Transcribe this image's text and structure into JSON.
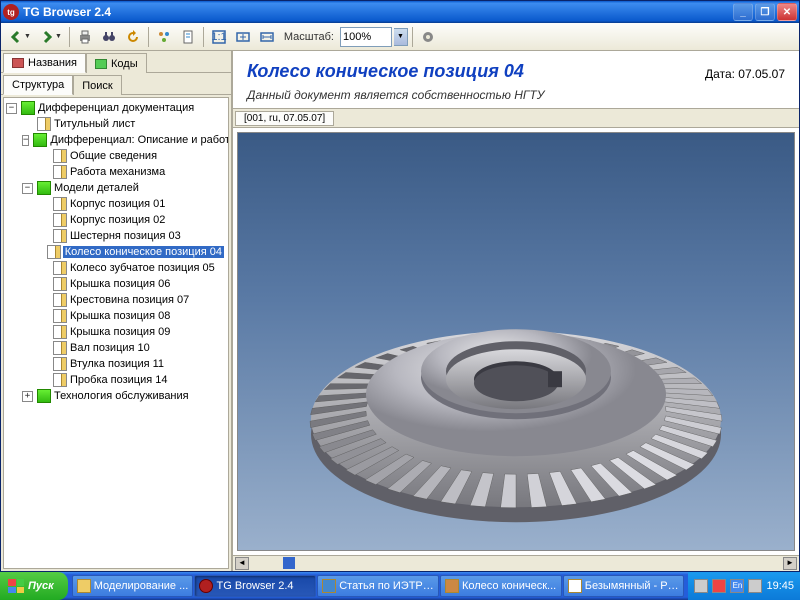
{
  "window": {
    "title": "TG Browser 2.4"
  },
  "toolbar": {
    "scale_label": "Масштаб:",
    "zoom": "100%"
  },
  "left_tabs": {
    "names": "Названия",
    "codes": "Коды",
    "structure": "Структура",
    "search": "Поиск"
  },
  "tree": {
    "root": "Дифференциал документация",
    "n0": "Титульный лист",
    "n1": "Дифференциал: Описание и работа",
    "n1_0": "Общие сведения",
    "n1_1": "Работа механизма",
    "n2": "Модели деталей",
    "n2_0": "Корпус позиция 01",
    "n2_1": "Корпус позиция 02",
    "n2_2": "Шестерня позиция 03",
    "n2_3": "Колесо коническое позиция 04",
    "n2_4": "Колесо зубчатое позиция 05",
    "n2_5": "Крышка позиция 06",
    "n2_6": "Крестовина позиция 07",
    "n2_7": "Крышка позиция 08",
    "n2_8": "Крышка позиция 09",
    "n2_9": "Вал позиция 10",
    "n2_10": "Втулка позиция 11",
    "n2_11": "Пробка позиция 14",
    "n3": "Технология обслуживания"
  },
  "doc": {
    "title": "Колесо коническое позиция 04",
    "date_label": "Дата: 07.05.07",
    "subtitle": "Данный документ является собственностью НГТУ",
    "tab": "[001, ru, 07.05.07]"
  },
  "taskbar": {
    "start": "Пуск",
    "items": [
      "Моделирование ...",
      "TG Browser 2.4",
      "Статья по ИЭТР ...",
      "Колесо коническ...",
      "Безымянный - Paint"
    ],
    "lang": "En",
    "clock": "19:45"
  }
}
